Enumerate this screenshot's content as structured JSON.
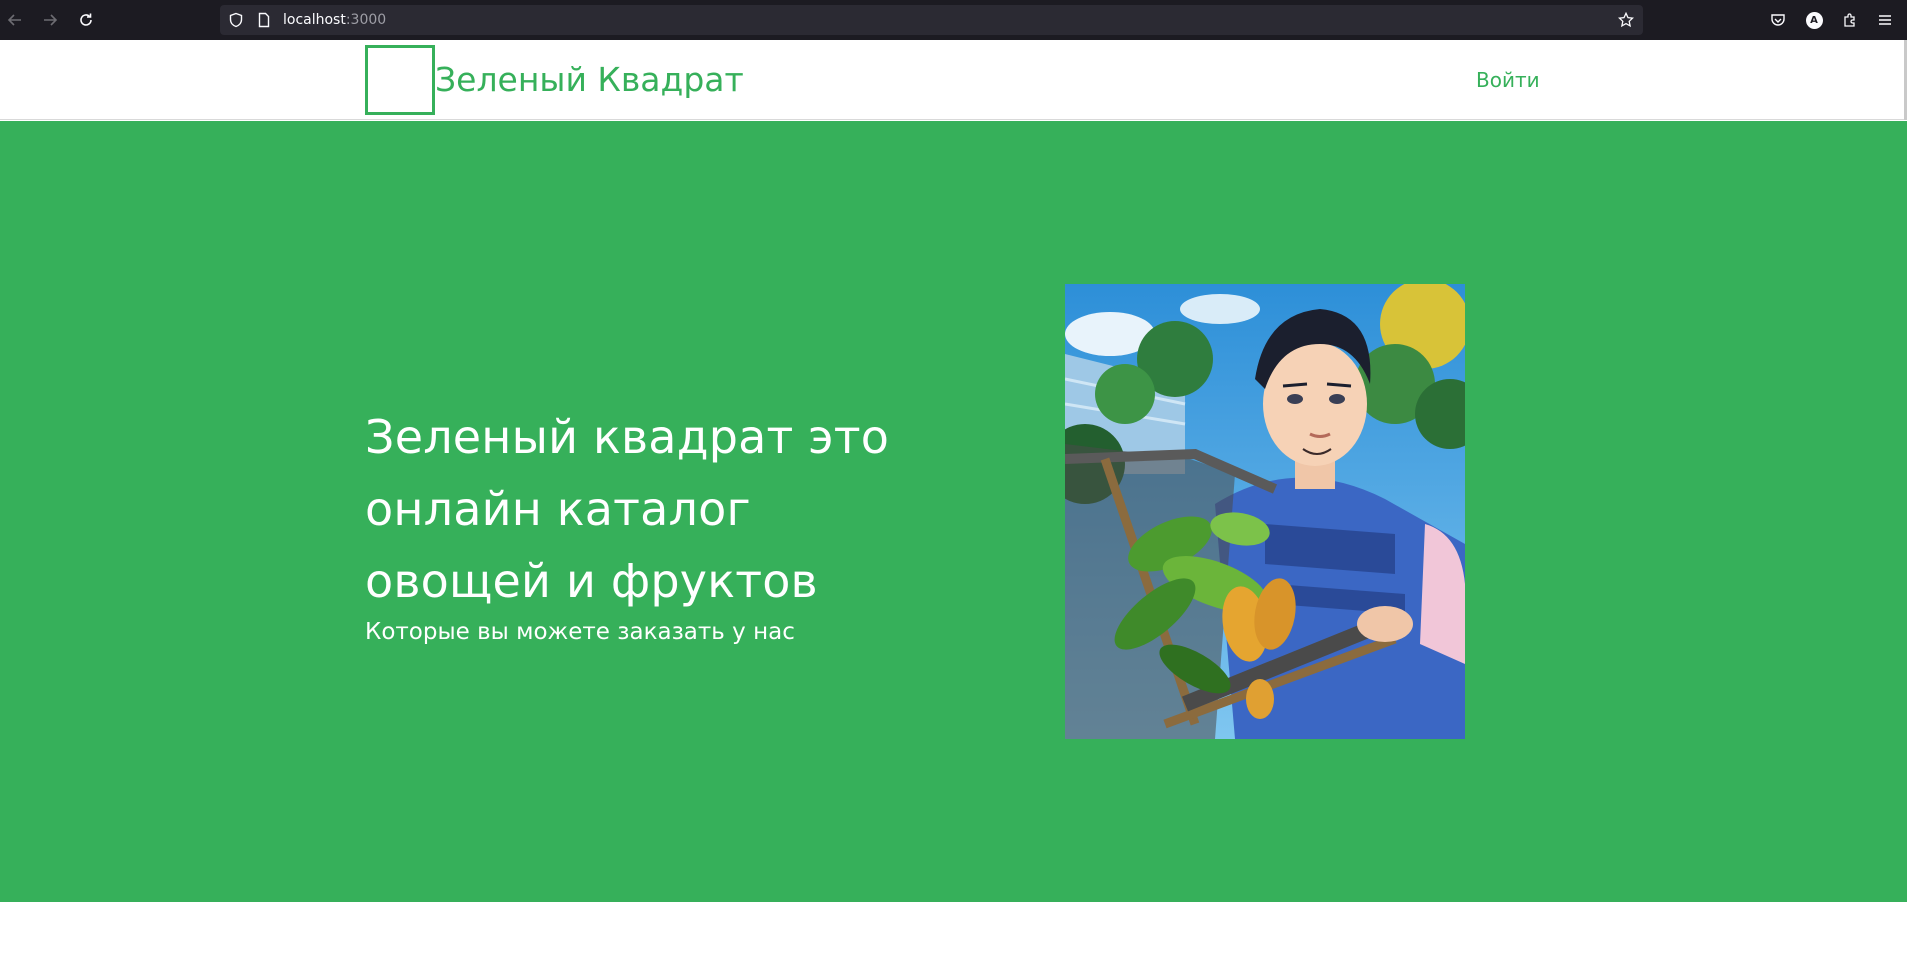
{
  "browser": {
    "url_host": "localhost",
    "url_port": ":3000",
    "icons": [
      "back-arrow-icon",
      "forward-arrow-icon",
      "reload-icon",
      "shield-icon",
      "page-icon",
      "star-icon",
      "pocket-icon",
      "account-icon",
      "extensions-icon",
      "menu-icon"
    ],
    "account_initial": "A"
  },
  "header": {
    "brand": "Зеленый Квадрат",
    "login": "Войти"
  },
  "hero": {
    "title": "Зеленый квадрат это онлайн каталог овощей и фруктов",
    "subtitle": "Которые вы можете заказать у нас",
    "image_subject": "anime-style man holding a basket of plants and fruits"
  },
  "colors": {
    "accent": "#36b05a",
    "browser_bg": "#1c1b22",
    "urlbar_bg": "#2b2a33"
  }
}
